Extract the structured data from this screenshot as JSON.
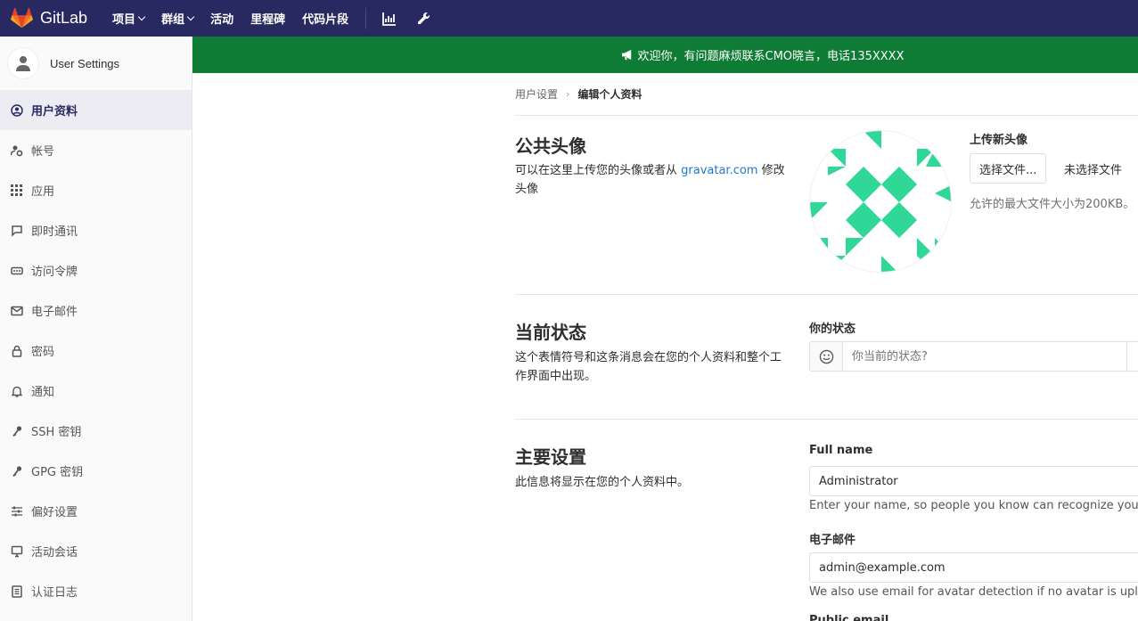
{
  "app": {
    "name": "GitLab"
  },
  "nav": {
    "items": [
      {
        "label": "项目",
        "dropdown": true
      },
      {
        "label": "群组",
        "dropdown": true
      },
      {
        "label": "活动",
        "dropdown": false
      },
      {
        "label": "里程碑",
        "dropdown": false
      },
      {
        "label": "代码片段",
        "dropdown": false
      }
    ],
    "icons": [
      "chart-icon",
      "wrench-icon"
    ]
  },
  "sidebar": {
    "title": "User Settings",
    "items": [
      {
        "label": "用户资料",
        "icon": "user-circle-icon",
        "active": true
      },
      {
        "label": "帐号",
        "icon": "user-gear-icon",
        "active": false
      },
      {
        "label": "应用",
        "icon": "grid-icon",
        "active": false
      },
      {
        "label": "即时通讯",
        "icon": "chat-icon",
        "active": false
      },
      {
        "label": "访问令牌",
        "icon": "token-icon",
        "active": false
      },
      {
        "label": "电子邮件",
        "icon": "mail-icon",
        "active": false
      },
      {
        "label": "密码",
        "icon": "lock-icon",
        "active": false
      },
      {
        "label": "通知",
        "icon": "bell-icon",
        "active": false
      },
      {
        "label": "SSH 密钥",
        "icon": "key-icon",
        "active": false
      },
      {
        "label": "GPG 密钥",
        "icon": "key-icon",
        "active": false
      },
      {
        "label": "偏好设置",
        "icon": "sliders-icon",
        "active": false
      },
      {
        "label": "活动会话",
        "icon": "monitor-icon",
        "active": false
      },
      {
        "label": "认证日志",
        "icon": "log-icon",
        "active": false
      }
    ]
  },
  "broadcast": {
    "message": "欢迎你，有问题麻烦联系CMO晓言，电话135XXXX",
    "icon": "megaphone-icon"
  },
  "breadcrumb": {
    "parent": "用户设置",
    "current": "编辑个人资料"
  },
  "avatar_section": {
    "title": "公共头像",
    "desc_prefix": "可以在这里上传您的头像或者从 ",
    "desc_link": "gravatar.com",
    "desc_suffix": " 修改头像",
    "upload_label": "上传新头像",
    "choose_button": "选择文件...",
    "no_file_text": "未选择文件",
    "max_size_help": "允许的最大文件大小为200KB。"
  },
  "status_section": {
    "title": "当前状态",
    "desc": "这个表情符号和这条消息会在您的个人资料和整个工作界面中出现。",
    "label": "你的状态",
    "placeholder": "你当前的状态?",
    "emoji_icon": "smiley-icon"
  },
  "main_section": {
    "title": "主要设置",
    "desc": "此信息将显示在您的个人资料中。",
    "fullname_label": "Full name",
    "fullname_value": "Administrator",
    "fullname_help": "Enter your name, so people you know can recognize you.",
    "email_label": "电子邮件",
    "email_value": "admin@example.com",
    "email_help": "We also use email for avatar detection if no avatar is upload",
    "public_email_label": "Public email"
  },
  "colors": {
    "navbar": "#292961",
    "broadcast": "#0e7c35",
    "identicon": "#2fd896",
    "link": "#1f78d1"
  }
}
